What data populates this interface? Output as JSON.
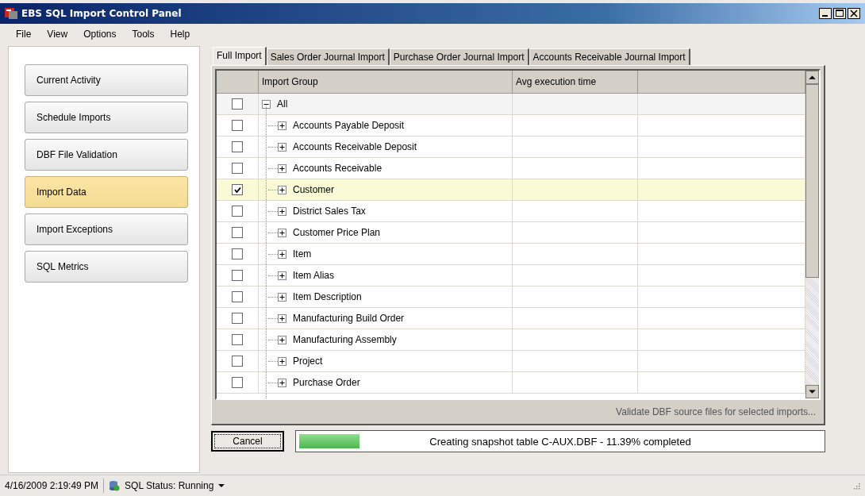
{
  "window": {
    "title": "EBS SQL Import Control Panel"
  },
  "menu": [
    "File",
    "View",
    "Options",
    "Tools",
    "Help"
  ],
  "nav": [
    {
      "label": "Current Activity",
      "selected": false
    },
    {
      "label": "Schedule Imports",
      "selected": false
    },
    {
      "label": "DBF File Validation",
      "selected": false
    },
    {
      "label": "Import Data",
      "selected": true
    },
    {
      "label": "Import Exceptions",
      "selected": false
    },
    {
      "label": "SQL Metrics",
      "selected": false
    }
  ],
  "tabs": [
    {
      "label": "Full Import",
      "selected": true
    },
    {
      "label": "Sales Order Journal Import",
      "selected": false
    },
    {
      "label": "Purchase Order Journal Import",
      "selected": false
    },
    {
      "label": "Accounts Receivable Journal Import",
      "selected": false
    }
  ],
  "table": {
    "columns": [
      "Import Group",
      "Avg execution time"
    ],
    "tree": [
      {
        "name": "All",
        "checked": false,
        "selected": false,
        "expanded": true,
        "children": [
          {
            "name": "Accounts Payable Deposit",
            "checked": false,
            "selected": false,
            "expanded": false
          },
          {
            "name": "Accounts Receivable Deposit",
            "checked": false,
            "selected": false,
            "expanded": false
          },
          {
            "name": "Accounts Receivable",
            "checked": false,
            "selected": false,
            "expanded": false
          },
          {
            "name": "Customer",
            "checked": true,
            "selected": true,
            "expanded": false
          },
          {
            "name": "District Sales Tax",
            "checked": false,
            "selected": false,
            "expanded": false
          },
          {
            "name": "Customer Price Plan",
            "checked": false,
            "selected": false,
            "expanded": false
          },
          {
            "name": "Item",
            "checked": false,
            "selected": false,
            "expanded": false
          },
          {
            "name": "Item Alias",
            "checked": false,
            "selected": false,
            "expanded": false
          },
          {
            "name": "Item Description",
            "checked": false,
            "selected": false,
            "expanded": false
          },
          {
            "name": "Manufacturing Build Order",
            "checked": false,
            "selected": false,
            "expanded": false
          },
          {
            "name": "Manufacturing Assembly",
            "checked": false,
            "selected": false,
            "expanded": false
          },
          {
            "name": "Project",
            "checked": false,
            "selected": false,
            "expanded": false
          },
          {
            "name": "Purchase Order",
            "checked": false,
            "selected": false,
            "expanded": false
          }
        ]
      }
    ]
  },
  "validate_link": "Validate DBF source files for selected imports...",
  "cancel_button": "Cancel",
  "progress": {
    "level": 0.1139,
    "text": "Creating snapshot table C-AUX.DBF - 11.39% completed"
  },
  "status_bar": {
    "timestamp": "4/16/2009 2:19:49 PM",
    "sql_status": "SQL Status: Running"
  }
}
